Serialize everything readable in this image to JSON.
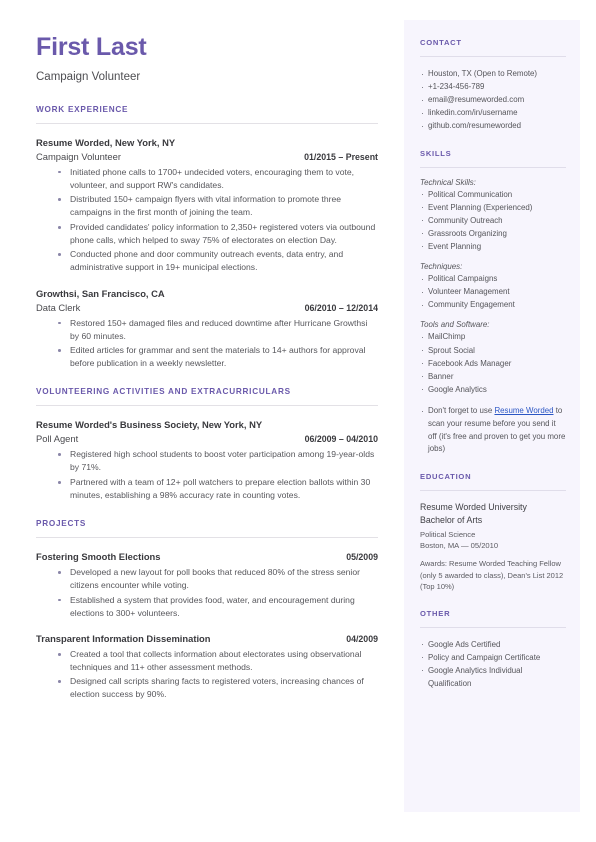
{
  "header": {
    "name": "First Last",
    "subtitle": "Campaign Volunteer"
  },
  "main": {
    "sections": [
      {
        "heading": "WORK EXPERIENCE",
        "entries": [
          {
            "org": "Resume Worded, New York, NY",
            "title": "Campaign Volunteer",
            "date": "01/2015 – Present",
            "bullets": [
              "Initiated phone calls to 1700+ undecided voters, encouraging them to vote, volunteer, and support RW's candidates.",
              "Distributed 150+ campaign flyers with vital information to promote three campaigns in the first month of joining the team.",
              "Provided candidates' policy information to 2,350+ registered voters via outbound phone calls, which helped to sway 75% of electorates on election Day.",
              "Conducted phone and door community outreach events, data entry, and administrative support in 19+ municipal elections."
            ]
          },
          {
            "org": "Growthsi, San Francisco, CA",
            "title": "Data Clerk",
            "date": "06/2010 – 12/2014",
            "bullets": [
              "Restored 150+ damaged files and reduced downtime after Hurricane Growthsi by 60 minutes.",
              "Edited articles for grammar and sent the materials to 14+ authors for approval before publication in a weekly newsletter."
            ]
          }
        ]
      },
      {
        "heading": "VOLUNTEERING ACTIVITIES AND EXTRACURRICULARS",
        "entries": [
          {
            "org": "Resume Worded's Business Society, New York, NY",
            "title": "Poll Agent",
            "date": "06/2009 – 04/2010",
            "bullets": [
              "Registered high school students to boost voter participation among 19-year-olds by 71%.",
              "Partnered with a team of 12+ poll watchers to prepare election ballots within 30 minutes, establishing a 98% accuracy rate in counting votes."
            ]
          }
        ]
      },
      {
        "heading": "PROJECTS",
        "entries": [
          {
            "org": "",
            "title": "Fostering Smooth Elections",
            "date": "05/2009",
            "title_bold": true,
            "bullets": [
              "Developed a new layout for poll books that reduced  80% of the stress senior citizens encounter while voting.",
              "Established a system that provides food, water, and encouragement during elections to 300+ volunteers."
            ]
          },
          {
            "org": "",
            "title": "Transparent Information Dissemination",
            "date": "04/2009",
            "title_bold": true,
            "bullets": [
              "Created a tool that collects information about electorates using observational techniques and 11+ other assessment methods.",
              "Designed call scripts sharing facts to registered voters, increasing chances of election success by 90%."
            ]
          }
        ]
      }
    ]
  },
  "sidebar": {
    "contact": {
      "heading": "CONTACT",
      "items": [
        "Houston, TX (Open to Remote)",
        "+1-234-456-789",
        "email@resumeworded.com",
        "linkedin.com/in/username",
        "github.com/resumeworded"
      ]
    },
    "skills": {
      "heading": "SKILLS",
      "groups": [
        {
          "label": "Technical Skills:",
          "items": [
            "Political Communication",
            "Event Planning (Experienced)",
            "Community Outreach",
            "Grassroots Organizing",
            "Event Planning"
          ]
        },
        {
          "label": "Techniques:",
          "items": [
            "Political Campaigns",
            "Volunteer Management",
            "Community Engagement"
          ]
        },
        {
          "label": "Tools and Software:",
          "items": [
            "MailChimp",
            "Sprout Social",
            "Facebook Ads Manager",
            "Banner",
            "Google Analytics"
          ]
        }
      ],
      "promo": {
        "before": "Don't forget to use ",
        "link": "Resume Worded",
        "after": " to scan your resume before you send it off (it's free and proven to get you more jobs)"
      }
    },
    "education": {
      "heading": "EDUCATION",
      "school": "Resume Worded University",
      "degree": "Bachelor of Arts",
      "field": "Political Science",
      "location": "Boston, MA — 05/2010",
      "awards": "Awards: Resume Worded Teaching Fellow (only 5 awarded to class), Dean's List 2012 (Top 10%)"
    },
    "other": {
      "heading": "OTHER",
      "items": [
        "Google Ads Certified",
        "Policy and Campaign Certificate",
        "Google Analytics Individual Qualification"
      ]
    }
  },
  "colors": {
    "accent": "#6a59ab",
    "sidebar_bg": "#f7f5fd",
    "link": "#2b56c4",
    "text": "#55555a"
  }
}
